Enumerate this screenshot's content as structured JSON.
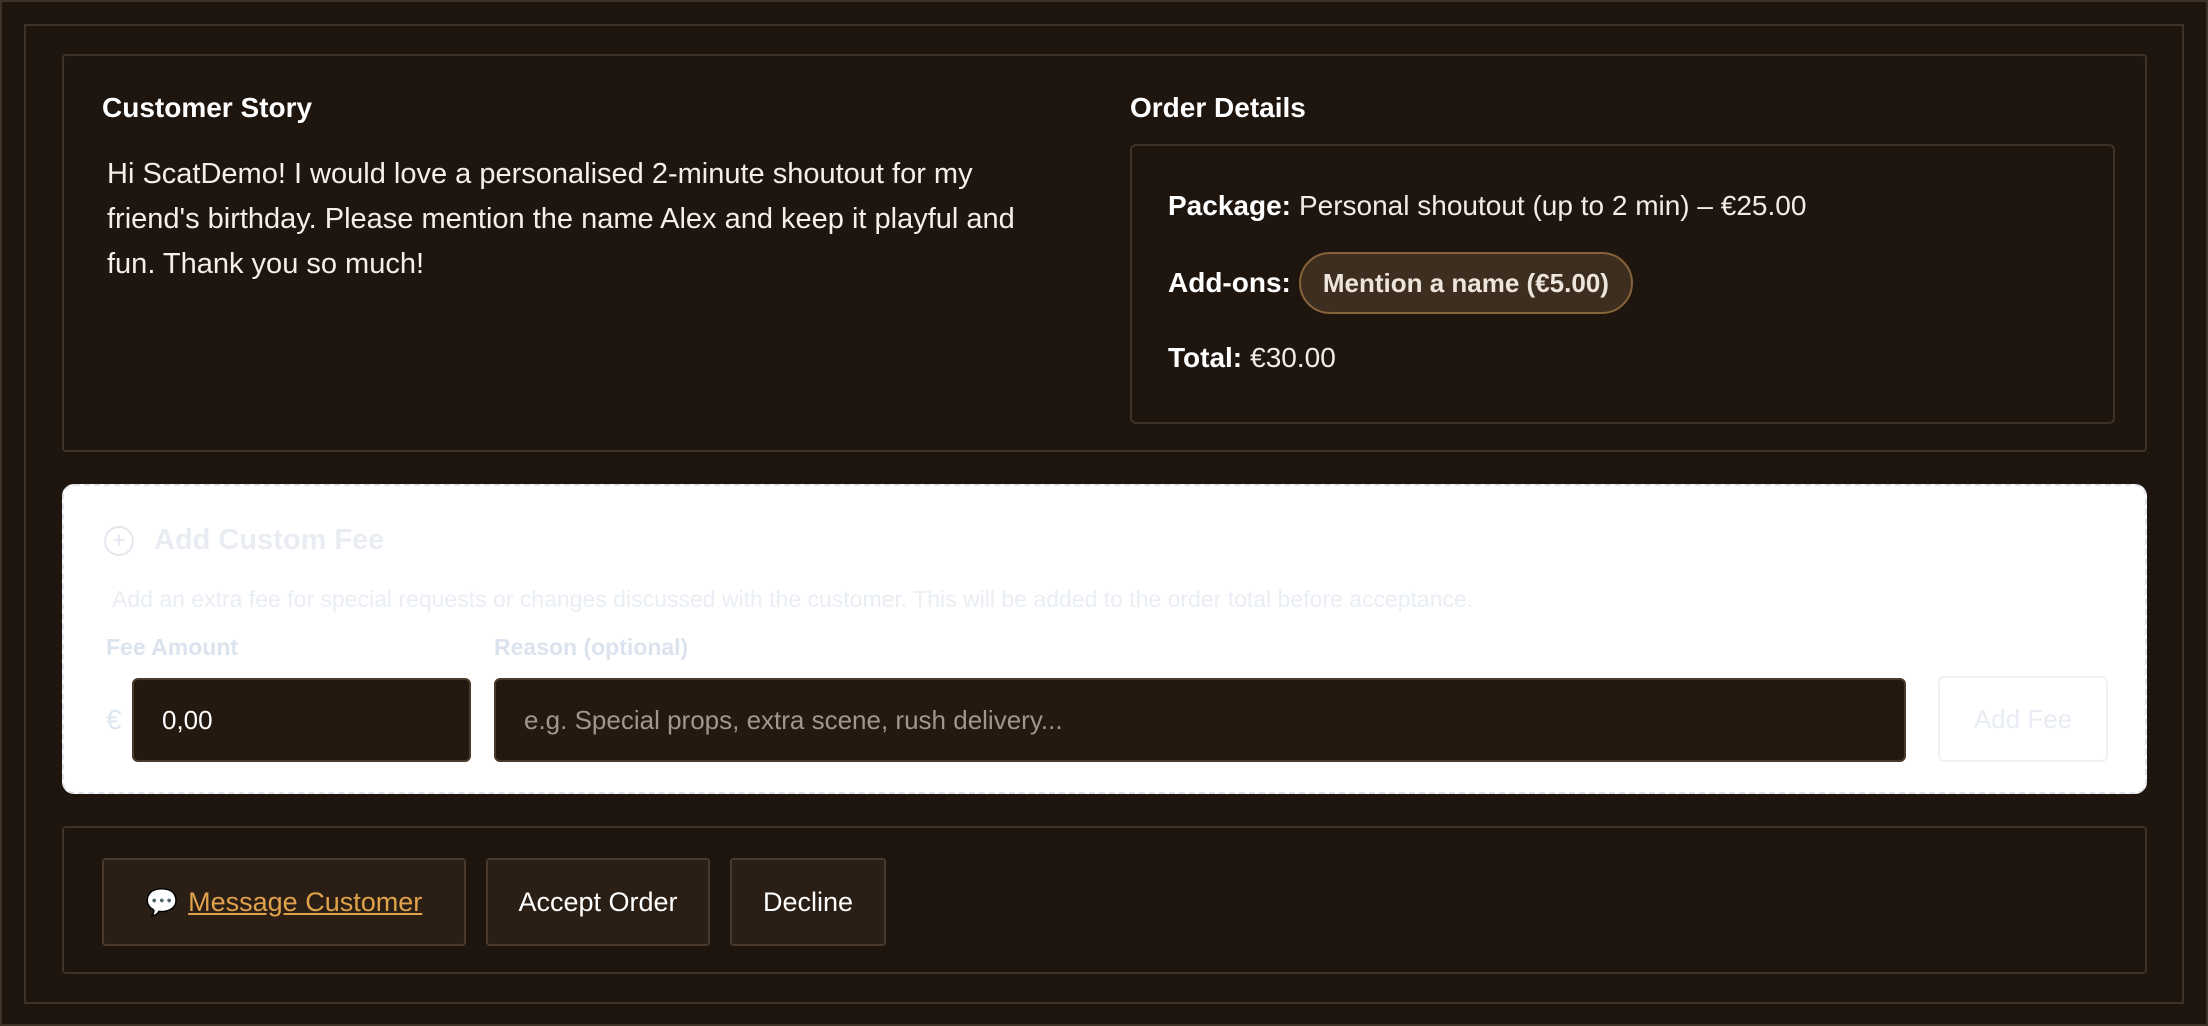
{
  "customer_story": {
    "title": "Customer Story",
    "text": "Hi ScatDemo! I would love a personalised 2-minute shoutout for my friend's birthday. Please mention the name Alex and keep it playful and fun. Thank you so much!"
  },
  "order_details": {
    "title": "Order Details",
    "package_label": "Package:",
    "package_value": "Personal shoutout (up to 2 min) – €25.00",
    "addons_label": "Add-ons:",
    "addons": [
      "Mention a name (€5.00)"
    ],
    "total_label": "Total:",
    "total_value": "€30.00"
  },
  "custom_fee": {
    "icon": "plus-circle-icon",
    "title": "Add Custom Fee",
    "description": "Add an extra fee for special requests or changes discussed with the customer. This will be added to the order total before acceptance.",
    "amount_label": "Fee Amount",
    "currency_symbol": "€",
    "amount_value": "0,00",
    "reason_label": "Reason (optional)",
    "reason_placeholder": "e.g. Special props, extra scene, rush delivery...",
    "add_button": "Add Fee"
  },
  "actions": {
    "message_icon": "speech-bubble-icon",
    "message_label": "Message Customer",
    "accept_label": "Accept Order",
    "decline_label": "Decline"
  },
  "colors": {
    "background": "#1f150f",
    "border": "#3f3226",
    "accent_link": "#e0a24a",
    "pill_bg": "#3e2e1f"
  }
}
